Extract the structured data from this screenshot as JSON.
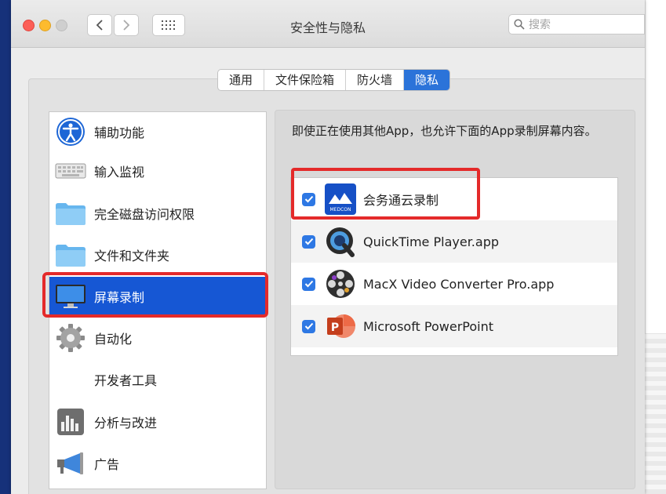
{
  "window": {
    "title": "安全性与隐私",
    "search_placeholder": "搜索"
  },
  "tabs": [
    {
      "label": "通用",
      "active": false
    },
    {
      "label": "文件保险箱",
      "active": false
    },
    {
      "label": "防火墙",
      "active": false
    },
    {
      "label": "隐私",
      "active": true
    }
  ],
  "sidebar": {
    "items": [
      {
        "label": "辅助功能",
        "icon": "accessibility-icon"
      },
      {
        "label": "输入监视",
        "icon": "keyboard-icon"
      },
      {
        "label": "完全磁盘访问权限",
        "icon": "folder-icon"
      },
      {
        "label": "文件和文件夹",
        "icon": "folder-icon"
      },
      {
        "label": "屏幕录制",
        "icon": "display-icon",
        "selected": true
      },
      {
        "label": "自动化",
        "icon": "gear-icon"
      },
      {
        "label": "开发者工具",
        "icon": ""
      },
      {
        "label": "分析与改进",
        "icon": "analytics-chart-icon"
      },
      {
        "label": "广告",
        "icon": "megaphone-icon"
      }
    ]
  },
  "main": {
    "description": "即使正在使用其他App，也允许下面的App录制屏幕内容。",
    "apps": [
      {
        "name": "会务通云录制",
        "checked": true,
        "icon": "medcon-app-icon",
        "icon_text": "MEDCON"
      },
      {
        "name": "QuickTime Player.app",
        "checked": true,
        "icon": "quicktime-icon"
      },
      {
        "name": "MacX Video Converter Pro.app",
        "checked": true,
        "icon": "film-reel-icon"
      },
      {
        "name": "Microsoft PowerPoint",
        "checked": true,
        "icon": "powerpoint-icon",
        "icon_text": "P"
      }
    ]
  },
  "colors": {
    "selection": "#1657d4",
    "checkbox": "#2e78e4",
    "annotation": "#e42a2a",
    "background": "#16317a"
  }
}
